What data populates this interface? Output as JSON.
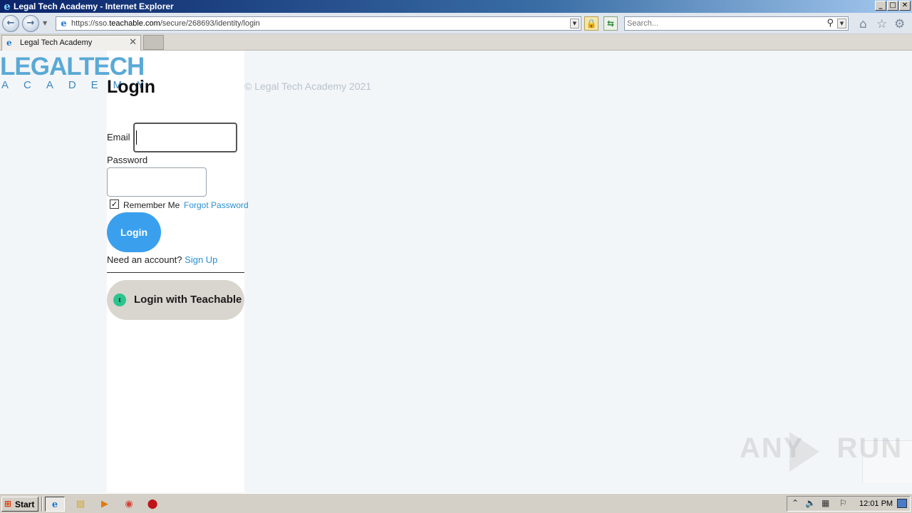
{
  "window": {
    "title": "Legal Tech Academy - Internet Explorer",
    "minimize": "_",
    "maximize": "□",
    "close": "✕"
  },
  "address_bar": {
    "back_icon": "back-arrow-icon",
    "forward_icon": "forward-arrow-icon",
    "url_prefix": "https://sso.",
    "url_host": "teachable.com",
    "url_path": "/secure/268693/identity/login",
    "search_placeholder": "Search...",
    "lock_icon": "lock-icon",
    "refresh_icon": "refresh-icon"
  },
  "toolbar_icons": [
    "home-icon",
    "favorites-star-icon",
    "settings-gear-icon"
  ],
  "tabs": [
    {
      "label": "Legal Tech Academy",
      "close": "✕"
    }
  ],
  "page": {
    "logo_line1": "LEGALTECH",
    "logo_line2": "ACADEMY",
    "heading": "Login",
    "copyright": "© Legal Tech Academy 2021",
    "email_label": "Email",
    "email_value": "",
    "password_label": "Password",
    "password_value": "",
    "remember_checked": true,
    "remember_label": "Remember Me",
    "forgot_link": "Forgot Password",
    "login_button": "Login",
    "need_account": "Need an account?",
    "signup_link": "Sign Up",
    "teachable_button": "Login with Teachable",
    "teachable_icon_letter": "t",
    "accent_color": "#3aa0ee",
    "link_color": "#2b8fd3"
  },
  "watermark": {
    "left": "ANY",
    "right": "RUN"
  },
  "taskbar": {
    "start_label": "Start",
    "apps": [
      "internet-explorer-icon",
      "file-explorer-icon",
      "media-player-icon",
      "chrome-icon",
      "antivirus-icon"
    ],
    "clock": "12:01 PM"
  }
}
